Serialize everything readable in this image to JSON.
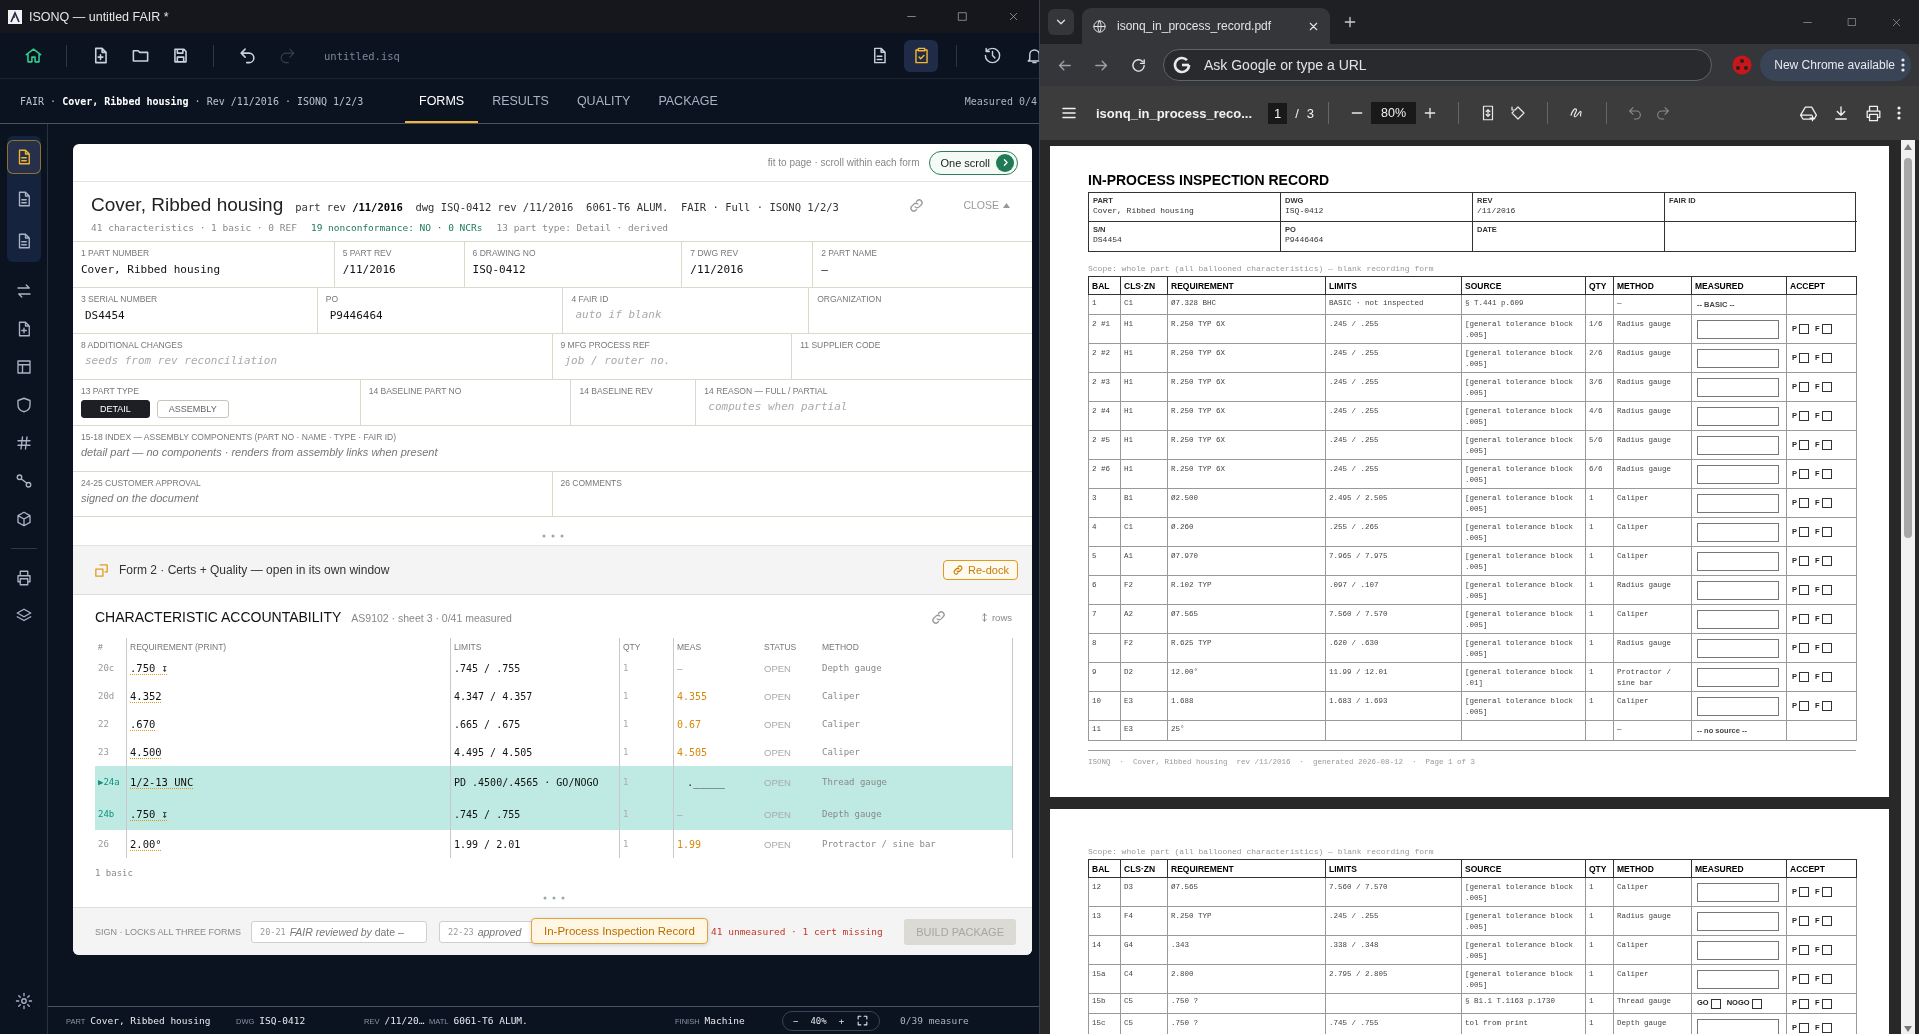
{
  "app": {
    "title": "ISONQ — untitled FAIR *",
    "toolbar": {
      "tools": [
        {
          "disabled": false
        },
        {
          "disabled": false
        },
        {
          "disabled": false
        },
        {
          "disabled": false
        },
        {
          "disabled": false
        },
        {
          "disabled": true
        }
      ],
      "file_name": "untitled.isq",
      "views": [
        {
          "selected": false
        },
        {
          "selected": true
        },
        {
          "selected": false
        },
        {
          "selected": false
        }
      ]
    },
    "breadcrumb": "FAIR · **Cover, Ribbed housing** · Rev /11/2016 · ISONQ 1/2/3",
    "tabs": [
      {
        "label": "FORMS",
        "selected": true
      },
      {
        "label": "RESULTS",
        "selected": false
      },
      {
        "label": "QUALITY",
        "selected": false
      },
      {
        "label": "PACKAGE",
        "selected": false
      }
    ],
    "measured": "Measured 0/4",
    "sidebar": {
      "forms": [
        {
          "selected": true
        },
        {
          "selected": false
        },
        {
          "selected": false
        }
      ],
      "tools": [
        {
          "selected": false
        },
        {
          "selected": false
        },
        {
          "selected": false
        },
        {
          "selected": false
        },
        {
          "selected": false
        },
        {
          "selected": false
        },
        {
          "selected": false
        },
        {
          "selected": false
        },
        {
          "selected": false
        }
      ],
      "settings": {
        "selected": false
      }
    },
    "card": {
      "scroll_hint": "fit to page · scroll within each form",
      "scroll_button": "One scroll",
      "title": "Cover, Ribbed housing",
      "meta": "part rev **/11/2016**  dwg ISQ-0412 rev /11/2016  6061-T6 ALUM.  FAIR · Full · ISONQ 1/2/3",
      "close": "CLOSE",
      "summary": [
        {
          "text": "41 characteristics · 1 basic · 0 REF",
          "kind": "muted"
        },
        {
          "text": "19 nonconformance: NO · 0 NCRs",
          "kind": "good"
        },
        {
          "text": "13 part type: Detail · derived",
          "kind": "muted"
        }
      ],
      "form_rows": [
        [
          {
            "label": "1 PART NUMBER",
            "kind": "value",
            "value": "Cover, Ribbed housing"
          },
          {
            "label": "5 PART REV",
            "kind": "value",
            "value": "/11/2016"
          },
          {
            "label": "6 DRAWING NO",
            "kind": "value",
            "value": "ISQ-0412"
          },
          {
            "label": "7 DWG REV",
            "kind": "value",
            "value": "/11/2016"
          },
          {
            "label": "2 PART NAME",
            "kind": "value",
            "value": "–"
          }
        ],
        [
          {
            "label": "3 SERIAL NUMBER",
            "kind": "input",
            "value": "DS4454"
          },
          {
            "label": "PO",
            "kind": "input",
            "value": "P9446464"
          },
          {
            "label": "4 FAIR ID",
            "kind": "input",
            "placeholder": "auto if blank"
          },
          {
            "label": "ORGANIZATION",
            "kind": "empty"
          }
        ],
        [
          {
            "label": "8 ADDITIONAL CHANGES",
            "kind": "input",
            "placeholder": "seeds from rev reconciliation"
          },
          {
            "label": "9 MFG PROCESS REF",
            "kind": "input",
            "placeholder": "job / router no."
          },
          {
            "label": "11 SUPPLIER CODE",
            "kind": "empty"
          }
        ],
        [
          {
            "label": "13 PART TYPE",
            "kind": "segmented",
            "options": [
              {
                "label": "DETAIL",
                "selected": true
              },
              {
                "label": "ASSEMBLY",
                "selected": false
              }
            ]
          },
          {
            "label": "14 BASELINE PART NO",
            "kind": "empty"
          },
          {
            "label": "14 BASELINE REV",
            "kind": "empty"
          },
          {
            "label": "14 REASON — FULL / PARTIAL",
            "kind": "input",
            "placeholder": "computes when partial"
          }
        ],
        [
          {
            "label": "15-18 INDEX — ASSEMBLY COMPONENTS (PART NO · NAME · TYPE · FAIR ID)",
            "kind": "note",
            "note": "detail part — no components · renders from assembly links when present"
          }
        ],
        [
          {
            "label": "24-25 CUSTOMER APPROVAL",
            "kind": "note",
            "note": "signed on the document"
          },
          {
            "label": "26 COMMENTS",
            "kind": "empty"
          }
        ]
      ],
      "form2": {
        "text": "Form 2 · Certs + Quality — open in its own window",
        "button": "Re-dock"
      },
      "accountability": {
        "title": "CHARACTERISTIC ACCOUNTABILITY",
        "subtitle": "AS9102 · sheet 3 · 0/41 measured",
        "rows_button": "rows",
        "columns": [
          "#",
          "REQUIREMENT (PRINT)",
          "LIMITS",
          "QTY",
          "MEAS",
          "STATUS",
          "METHOD"
        ],
        "rows": [
          {
            "num": "20c",
            "requirement": ".750 ↧",
            "limits": ".745 / .755",
            "qty": "1",
            "meas": {
              "text": "–",
              "kind": "empty"
            },
            "status": "OPEN",
            "method": "Depth gauge",
            "selected": false
          },
          {
            "num": "20d",
            "requirement": "4.352",
            "limits": "4.347 / 4.357",
            "qty": "1",
            "meas": {
              "text": "4.355",
              "kind": "value"
            },
            "status": "OPEN",
            "method": "Caliper",
            "selected": false
          },
          {
            "num": "22",
            "requirement": ".670",
            "limits": ".665 / .675",
            "qty": "1",
            "meas": {
              "text": "0.67",
              "kind": "value"
            },
            "status": "OPEN",
            "method": "Caliper",
            "selected": false
          },
          {
            "num": "23",
            "requirement": "4.500",
            "limits": "4.495 / 4.505",
            "qty": "1",
            "meas": {
              "text": "4.505",
              "kind": "value"
            },
            "status": "OPEN",
            "method": "Caliper",
            "selected": false
          },
          {
            "marker": "▶",
            "num": "24a",
            "requirement": "1/2-13 UNC",
            "limits": "PD .4500/.4565 · GO/NOGO",
            "qty": "1",
            "meas": {
              "text": "._____",
              "kind": "entry"
            },
            "status": "OPEN",
            "method": "Thread gauge",
            "selected": true
          },
          {
            "num": "24b",
            "requirement": ".750 ↧",
            "limits": ".745 / .755",
            "qty": "1",
            "meas": {
              "text": "–",
              "kind": "empty"
            },
            "status": "OPEN",
            "method": "Depth gauge",
            "selected": true
          },
          {
            "num": "26",
            "requirement": "2.00°",
            "limits": "1.99 / 2.01",
            "qty": "1",
            "meas": {
              "text": "1.99",
              "kind": "value"
            },
            "status": "OPEN",
            "method": "Protractor / sine bar",
            "selected": false
          }
        ],
        "footer": "1 basic"
      },
      "sign": {
        "label": "SIGN · LOCKS ALL THREE FORMS",
        "fields": [
          {
            "code": "20-21",
            "value": "*FAIR reviewed by* date –"
          },
          {
            "code": "22-23",
            "value": "*approved*"
          }
        ],
        "tooltip": "In-Process Inspection Record",
        "warning": "41 unmeasured · 1 cert missing",
        "build": {
          "label": "BUILD PACKAGE",
          "disabled": true
        }
      }
    },
    "status_bar": {
      "items": [
        {
          "label": "PART",
          "value": "Cover, Ribbed housing"
        },
        {
          "label": "DWG",
          "value": "ISQ-0412"
        },
        {
          "label": "REV",
          "value": "/11/20…"
        },
        {
          "label": "MATL",
          "value": "6061-T6 ALUM."
        },
        {
          "label": "FINISH",
          "value": "Machine"
        }
      ],
      "zoom_out": "−",
      "zoom": "40%",
      "zoom_in": "+",
      "measured": "0/39 measure"
    }
  },
  "browser": {
    "tab_title": "isonq_in_process_record.pdf",
    "omnibox_placeholder": "Ask Google or type a URL",
    "update_button": "New Chrome available",
    "pdf": {
      "file_name": "isonq_in_process_reco...",
      "page": "1",
      "page_sep": "/",
      "page_count": "3",
      "zoom": "80%",
      "pages": [
        {
          "title": "IN-PROCESS INSPECTION RECORD",
          "header_fields": [
            {
              "label": "PART",
              "value": "Cover, Ribbed housing"
            },
            {
              "label": "DWG",
              "value": "ISQ-0412"
            },
            {
              "label": "REV",
              "value": "/11/2016"
            },
            {
              "label": "FAIR ID"
            },
            {
              "label": "S/N",
              "value": "DS4454"
            },
            {
              "label": "PO",
              "value": "P9446464"
            },
            {
              "label": "DATE"
            }
          ],
          "scope": "Scope: whole part (all ballooned characteristics) — blank recording form",
          "columns": [
            "BAL",
            "CLS·ZN",
            "REQUIREMENT",
            "LIMITS",
            "SOURCE",
            "QTY",
            "METHOD",
            "MEASURED",
            "ACCEPT"
          ],
          "rows": [
            {
              "bal": "1",
              "zone": "C1",
              "requirement": "Ø7.328 BHC",
              "limits": "BASIC · not inspected",
              "source": "§ T.441 p.609",
              "qty": "",
              "method": "—",
              "kind": "basic",
              "measured": "-- BASIC --"
            },
            {
              "bal": "2 #1",
              "zone": "H1",
              "requirement": "R.250 TYP 6X",
              "limits": ".245 / .255",
              "source": "[general tolerance block .005]",
              "qty": "1/6",
              "method": "Radius gauge",
              "kind": "input",
              "accept": [
                {
                  "label": "P",
                  "checked": false
                },
                {
                  "label": "F",
                  "checked": false
                }
              ]
            },
            {
              "bal": "2 #2",
              "zone": "H1",
              "requirement": "R.250 TYP 6X",
              "limits": ".245 / .255",
              "source": "[general tolerance block .005]",
              "qty": "2/6",
              "method": "Radius gauge",
              "kind": "input",
              "accept": [
                {
                  "label": "P",
                  "checked": false
                },
                {
                  "label": "F",
                  "checked": false
                }
              ]
            },
            {
              "bal": "2 #3",
              "zone": "H1",
              "requirement": "R.250 TYP 6X",
              "limits": ".245 / .255",
              "source": "[general tolerance block .005]",
              "qty": "3/6",
              "method": "Radius gauge",
              "kind": "input",
              "accept": [
                {
                  "label": "P",
                  "checked": false
                },
                {
                  "label": "F",
                  "checked": false
                }
              ]
            },
            {
              "bal": "2 #4",
              "zone": "H1",
              "requirement": "R.250 TYP 6X",
              "limits": ".245 / .255",
              "source": "[general tolerance block .005]",
              "qty": "4/6",
              "method": "Radius gauge",
              "kind": "input",
              "accept": [
                {
                  "label": "P",
                  "checked": false
                },
                {
                  "label": "F",
                  "checked": false
                }
              ]
            },
            {
              "bal": "2 #5",
              "zone": "H1",
              "requirement": "R.250 TYP 6X",
              "limits": ".245 / .255",
              "source": "[general tolerance block .005]",
              "qty": "5/6",
              "method": "Radius gauge",
              "kind": "input",
              "accept": [
                {
                  "label": "P",
                  "checked": false
                },
                {
                  "label": "F",
                  "checked": false
                }
              ]
            },
            {
              "bal": "2 #6",
              "zone": "H1",
              "requirement": "R.250 TYP 6X",
              "limits": ".245 / .255",
              "source": "[general tolerance block .005]",
              "qty": "6/6",
              "method": "Radius gauge",
              "kind": "input",
              "accept": [
                {
                  "label": "P",
                  "checked": false
                },
                {
                  "label": "F",
                  "checked": false
                }
              ]
            },
            {
              "bal": "3",
              "zone": "B1",
              "requirement": "Ø2.500",
              "limits": "2.495 / 2.505",
              "source": "[general tolerance block .005]",
              "qty": "1",
              "method": "Caliper",
              "kind": "input",
              "accept": [
                {
                  "label": "P",
                  "checked": false
                },
                {
                  "label": "F",
                  "checked": false
                }
              ]
            },
            {
              "bal": "4",
              "zone": "C1",
              "requirement": "Ø.260",
              "limits": ".255 / .265",
              "source": "[general tolerance block .005]",
              "qty": "1",
              "method": "Caliper",
              "kind": "input",
              "accept": [
                {
                  "label": "P",
                  "checked": false
                },
                {
                  "label": "F",
                  "checked": false
                }
              ]
            },
            {
              "bal": "5",
              "zone": "A1",
              "requirement": "Ø7.970",
              "limits": "7.965 / 7.975",
              "source": "[general tolerance block .005]",
              "qty": "1",
              "method": "Caliper",
              "kind": "input",
              "accept": [
                {
                  "label": "P",
                  "checked": false
                },
                {
                  "label": "F",
                  "checked": false
                }
              ]
            },
            {
              "bal": "6",
              "zone": "F2",
              "requirement": "R.102 TYP",
              "limits": ".097 / .107",
              "source": "[general tolerance block .005]",
              "qty": "1",
              "method": "Radius gauge",
              "kind": "input",
              "accept": [
                {
                  "label": "P",
                  "checked": false
                },
                {
                  "label": "F",
                  "checked": false
                }
              ]
            },
            {
              "bal": "7",
              "zone": "A2",
              "requirement": "Ø7.565",
              "limits": "7.560 / 7.570",
              "source": "[general tolerance block .005]",
              "qty": "1",
              "method": "Caliper",
              "kind": "input",
              "accept": [
                {
                  "label": "P",
                  "checked": false
                },
                {
                  "label": "F",
                  "checked": false
                }
              ]
            },
            {
              "bal": "8",
              "zone": "F2",
              "requirement": "R.625 TYP",
              "limits": ".620 / .630",
              "source": "[general tolerance block .005]",
              "qty": "1",
              "method": "Radius gauge",
              "kind": "input",
              "accept": [
                {
                  "label": "P",
                  "checked": false
                },
                {
                  "label": "F",
                  "checked": false
                }
              ]
            },
            {
              "bal": "9",
              "zone": "D2",
              "requirement": "12.00°",
              "limits": "11.99 / 12.01",
              "source": "[general tolerance block .01]",
              "qty": "1",
              "method": "Protractor / sine bar",
              "kind": "input",
              "accept": [
                {
                  "label": "P",
                  "checked": false
                },
                {
                  "label": "F",
                  "checked": false
                }
              ]
            },
            {
              "bal": "10",
              "zone": "E3",
              "requirement": "1.688",
              "limits": "1.683 / 1.693",
              "source": "[general tolerance block .005]",
              "qty": "1",
              "method": "Caliper",
              "kind": "input",
              "accept": [
                {
                  "label": "P",
                  "checked": false
                },
                {
                  "label": "F",
                  "checked": false
                }
              ]
            },
            {
              "bal": "11",
              "zone": "E3",
              "requirement": "25°",
              "limits": "",
              "source": "",
              "qty": "",
              "method": "—",
              "kind": "none",
              "measured": "-- no source --"
            }
          ],
          "footer": "ISONQ  ·  Cover, Ribbed housing  rev /11/2016  ·  generated 2026-08-12  ·  Page 1 of 3"
        },
        {
          "scope": "Scope: whole part (all ballooned characteristics) — blank recording form",
          "columns": [
            "BAL",
            "CLS·ZN",
            "REQUIREMENT",
            "LIMITS",
            "SOURCE",
            "QTY",
            "METHOD",
            "MEASURED",
            "ACCEPT"
          ],
          "rows": [
            {
              "bal": "12",
              "zone": "D3",
              "requirement": "Ø7.565",
              "limits": "7.560 / 7.570",
              "source": "[general tolerance block .005]",
              "qty": "1",
              "method": "Caliper",
              "kind": "input",
              "accept": [
                {
                  "label": "P",
                  "checked": false
                },
                {
                  "label": "F",
                  "checked": false
                }
              ]
            },
            {
              "bal": "13",
              "zone": "F4",
              "requirement": "R.250 TYP",
              "limits": ".245 / .255",
              "source": "[general tolerance block .005]",
              "qty": "1",
              "method": "Radius gauge",
              "kind": "input",
              "accept": [
                {
                  "label": "P",
                  "checked": false
                },
                {
                  "label": "F",
                  "checked": false
                }
              ]
            },
            {
              "bal": "14",
              "zone": "G4",
              "requirement": ".343",
              "limits": ".338 / .348",
              "source": "[general tolerance block .005]",
              "qty": "1",
              "method": "Caliper",
              "kind": "input",
              "accept": [
                {
                  "label": "P",
                  "checked": false
                },
                {
                  "label": "F",
                  "checked": false
                }
              ]
            },
            {
              "bal": "15a",
              "zone": "C4",
              "requirement": "2.800",
              "limits": "2.795 / 2.805",
              "source": "[general tolerance block .005]",
              "qty": "1",
              "method": "Caliper",
              "kind": "input",
              "accept": [
                {
                  "label": "P",
                  "checked": false
                },
                {
                  "label": "F",
                  "checked": false
                }
              ]
            },
            {
              "bal": "15b",
              "zone": "C5",
              "requirement": ".750 ?",
              "limits": "",
              "source": "§ B1.1 T.1163 p.1730",
              "qty": "1",
              "method": "Thread gauge",
              "kind": "gonogo",
              "gauges": [
                {
                  "label": "GO",
                  "checked": false
                },
                {
                  "label": "NOGO",
                  "checked": false
                }
              ],
              "accept": [
                {
                  "label": "P",
                  "checked": false
                },
                {
                  "label": "F",
                  "checked": false
                }
              ]
            },
            {
              "bal": "15c",
              "zone": "C5",
              "requirement": ".750 ?",
              "limits": ".745 / .755",
              "source": "tol from print",
              "qty": "1",
              "method": "Depth gauge",
              "kind": "input",
              "accept": [
                {
                  "label": "P",
                  "checked": false
                },
                {
                  "label": "F",
                  "checked": false
                }
              ]
            }
          ]
        }
      ]
    }
  }
}
